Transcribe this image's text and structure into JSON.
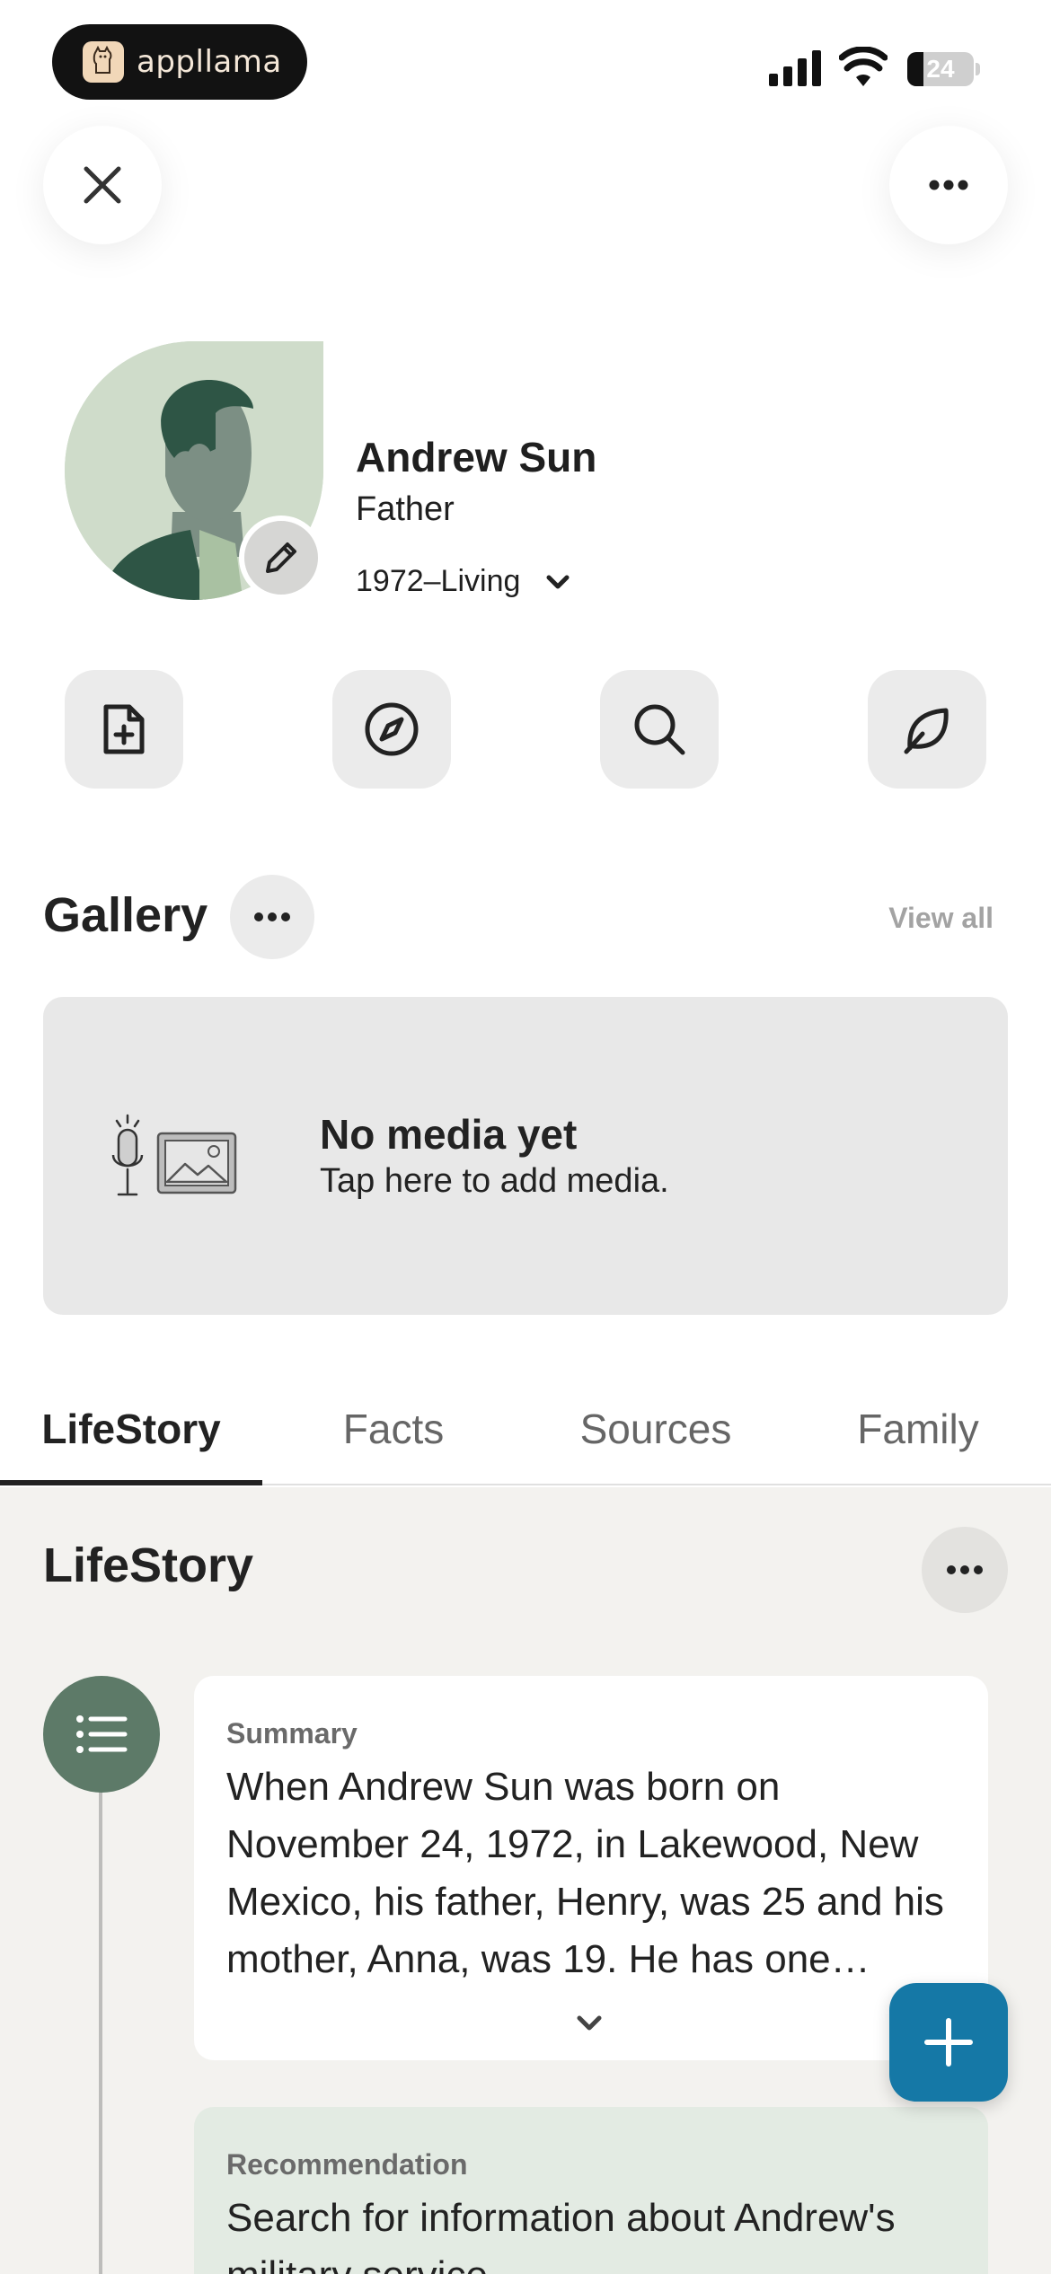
{
  "status_bar": {
    "brand_name": "appllama",
    "battery_level": "24",
    "battery_fraction": 0.24
  },
  "header": {
    "close_icon": "close-icon",
    "more_icon": "more-horizontal-icon"
  },
  "profile": {
    "name": "Andrew Sun",
    "relationship": "Father",
    "dates": "1972–Living"
  },
  "actions": [
    {
      "icon": "add-document-icon"
    },
    {
      "icon": "compass-icon"
    },
    {
      "icon": "search-icon"
    },
    {
      "icon": "leaf-icon"
    }
  ],
  "gallery": {
    "title": "Gallery",
    "view_all": "View all",
    "empty_title": "No media yet",
    "empty_subtitle": "Tap here to add media."
  },
  "tabs": [
    {
      "label": "LifeStory",
      "active": true
    },
    {
      "label": "Facts",
      "active": false
    },
    {
      "label": "Sources",
      "active": false
    },
    {
      "label": "Family",
      "active": false
    }
  ],
  "lifestory": {
    "title": "LifeStory",
    "summary_label": "Summary",
    "summary_text": "When Andrew Sun was born on November 24, 1972, in Lakewood, New Mexico, his father, Henry, was 25 and his mother, Anna, was 19. He has one…",
    "recommendation_label": "Recommendation",
    "recommendation_text": "Search for information about Andrew's military service"
  },
  "colors": {
    "accent_blue": "#1578a6",
    "timeline_green": "#5d7a68",
    "recommendation_bg": "#e3ebe3"
  }
}
